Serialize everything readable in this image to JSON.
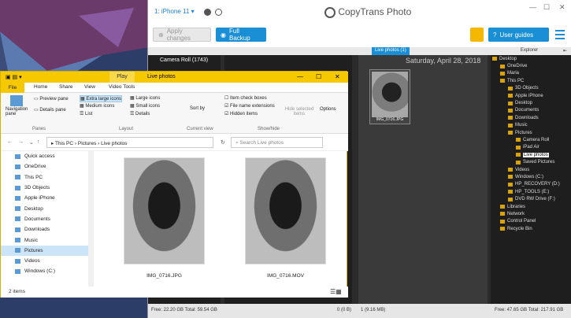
{
  "colors": {
    "accent": "#1a8fd6",
    "explorer_title": "#f5c800"
  },
  "copytrans": {
    "device": "iPhone 11",
    "logo": "CopyTrans Photo",
    "apply_changes": "Apply changes",
    "full_backup": "Full Backup",
    "user_guides": "User guides",
    "camera_roll": "Camera Roll (1743)",
    "live_photos_tab": "Live photos (1)",
    "date": "Saturday, April 28, 2018",
    "thumb_caption": "IMG_0716.JPG",
    "explorer_label": "Explorer",
    "tree": [
      {
        "label": "Desktop",
        "depth": 0
      },
      {
        "label": "OneDrive",
        "depth": 1
      },
      {
        "label": "Maria",
        "depth": 1
      },
      {
        "label": "This PC",
        "depth": 1
      },
      {
        "label": "3D Objects",
        "depth": 2
      },
      {
        "label": "Apple iPhone",
        "depth": 2
      },
      {
        "label": "Desktop",
        "depth": 2
      },
      {
        "label": "Documents",
        "depth": 2
      },
      {
        "label": "Downloads",
        "depth": 2
      },
      {
        "label": "Music",
        "depth": 2
      },
      {
        "label": "Pictures",
        "depth": 2
      },
      {
        "label": "Camera Roll",
        "depth": 3
      },
      {
        "label": "iPad Air",
        "depth": 3
      },
      {
        "label": "Live photos",
        "depth": 3,
        "selected": true
      },
      {
        "label": "Saved Pictures",
        "depth": 3
      },
      {
        "label": "Videos",
        "depth": 2
      },
      {
        "label": "Windows (C:)",
        "depth": 2
      },
      {
        "label": "HP_RECOVERY (D:)",
        "depth": 2
      },
      {
        "label": "HP_TOOLS (E:)",
        "depth": 2
      },
      {
        "label": "DVD RW Drive (F:)",
        "depth": 2
      },
      {
        "label": "Libraries",
        "depth": 1
      },
      {
        "label": "Network",
        "depth": 1
      },
      {
        "label": "Control Panel",
        "depth": 1
      },
      {
        "label": "Recycle Bin",
        "depth": 1
      }
    ],
    "status_left": "Free: 22.20 GB Total: 59.54 GB",
    "status_mid1": "0 (0 B)",
    "status_mid2": "1 (9.16 MB)",
    "status_right": "Free: 47.65 GB Total: 217.91 GB"
  },
  "explorer": {
    "play_tab": "Play",
    "title": "Live photos",
    "tabs": [
      "File",
      "Home",
      "Share",
      "View",
      "Video Tools"
    ],
    "ribbon": {
      "navigation_pane": "Navigation pane",
      "preview_pane": "Preview pane",
      "details_pane": "Details pane",
      "extra_large_icons": "Extra large icons",
      "large_icons": "Large icons",
      "medium_icons": "Medium icons",
      "small_icons": "Small icons",
      "list": "List",
      "details": "Details",
      "sort_by": "Sort by",
      "item_check_boxes": "Item check boxes",
      "file_name_extensions": "File name extensions",
      "hidden_items": "Hidden items",
      "hide_selected_items": "Hide selected items",
      "options": "Options",
      "group_panes": "Panes",
      "group_layout": "Layout",
      "group_current_view": "Current view",
      "group_show_hide": "Show/hide"
    },
    "breadcrumb": [
      "This PC",
      "Pictures",
      "Live photos"
    ],
    "search_placeholder": "Search Live photos",
    "nav": [
      {
        "label": "Quick access"
      },
      {
        "label": "OneDrive"
      },
      {
        "label": "This PC"
      },
      {
        "label": "3D Objects"
      },
      {
        "label": "Apple iPhone"
      },
      {
        "label": "Desktop"
      },
      {
        "label": "Documents"
      },
      {
        "label": "Downloads"
      },
      {
        "label": "Music"
      },
      {
        "label": "Pictures",
        "selected": true
      },
      {
        "label": "Videos"
      },
      {
        "label": "Windows (C:)"
      }
    ],
    "files": [
      {
        "name": "IMG_0716.JPG"
      },
      {
        "name": "IMG_0716.MOV"
      }
    ],
    "status": "2 items"
  }
}
